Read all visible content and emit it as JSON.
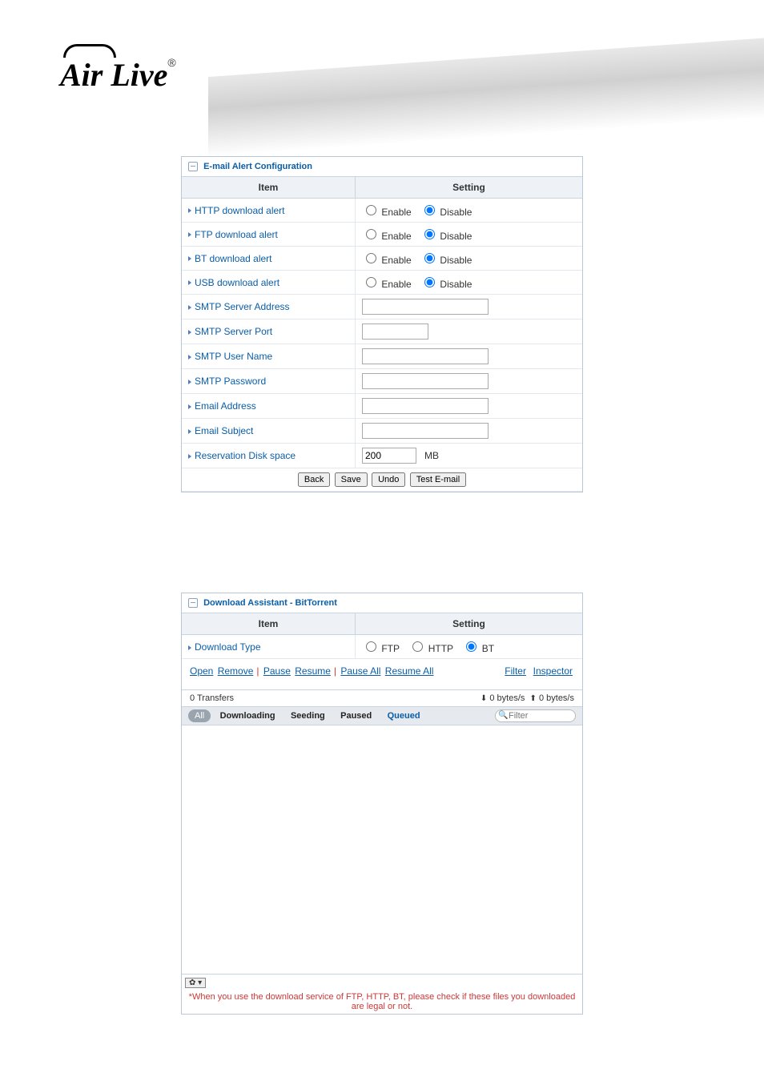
{
  "brand": "Air Live",
  "email_panel": {
    "title": "E-mail Alert Configuration",
    "header_item": "Item",
    "header_setting": "Setting",
    "enable": "Enable",
    "disable": "Disable",
    "rows": {
      "http": "HTTP download alert",
      "ftp": "FTP download alert",
      "bt": "BT download alert",
      "usb": "USB download alert",
      "smtp_addr": "SMTP Server Address",
      "smtp_port": "SMTP Server Port",
      "smtp_user": "SMTP User Name",
      "smtp_pass": "SMTP Password",
      "email_addr": "Email Address",
      "email_subj": "Email Subject",
      "resv": "Reservation Disk space"
    },
    "resv_value": "200",
    "resv_unit": "MB",
    "buttons": {
      "back": "Back",
      "save": "Save",
      "undo": "Undo",
      "test": "Test E-mail"
    }
  },
  "bt_panel": {
    "title": "Download Assistant - BitTorrent",
    "header_item": "Item",
    "header_setting": "Setting",
    "download_type_label": "Download Type",
    "types": {
      "ftp": "FTP",
      "http": "HTTP",
      "bt": "BT"
    },
    "toolbar": {
      "open": "Open",
      "remove": "Remove",
      "pause": "Pause",
      "resume": "Resume",
      "pause_all": "Pause All",
      "resume_all": "Resume All",
      "filter": "Filter",
      "inspector": "Inspector"
    },
    "transfers_label": "0 Transfers",
    "dl_speed": "0 bytes/s",
    "ul_speed": "0 bytes/s",
    "tabs": {
      "all": "All",
      "downloading": "Downloading",
      "seeding": "Seeding",
      "paused": "Paused",
      "queued": "Queued"
    },
    "filter_placeholder": "Filter",
    "warning": "*When you use the download service of FTP, HTTP, BT, please check if these files you downloaded are legal or not."
  }
}
